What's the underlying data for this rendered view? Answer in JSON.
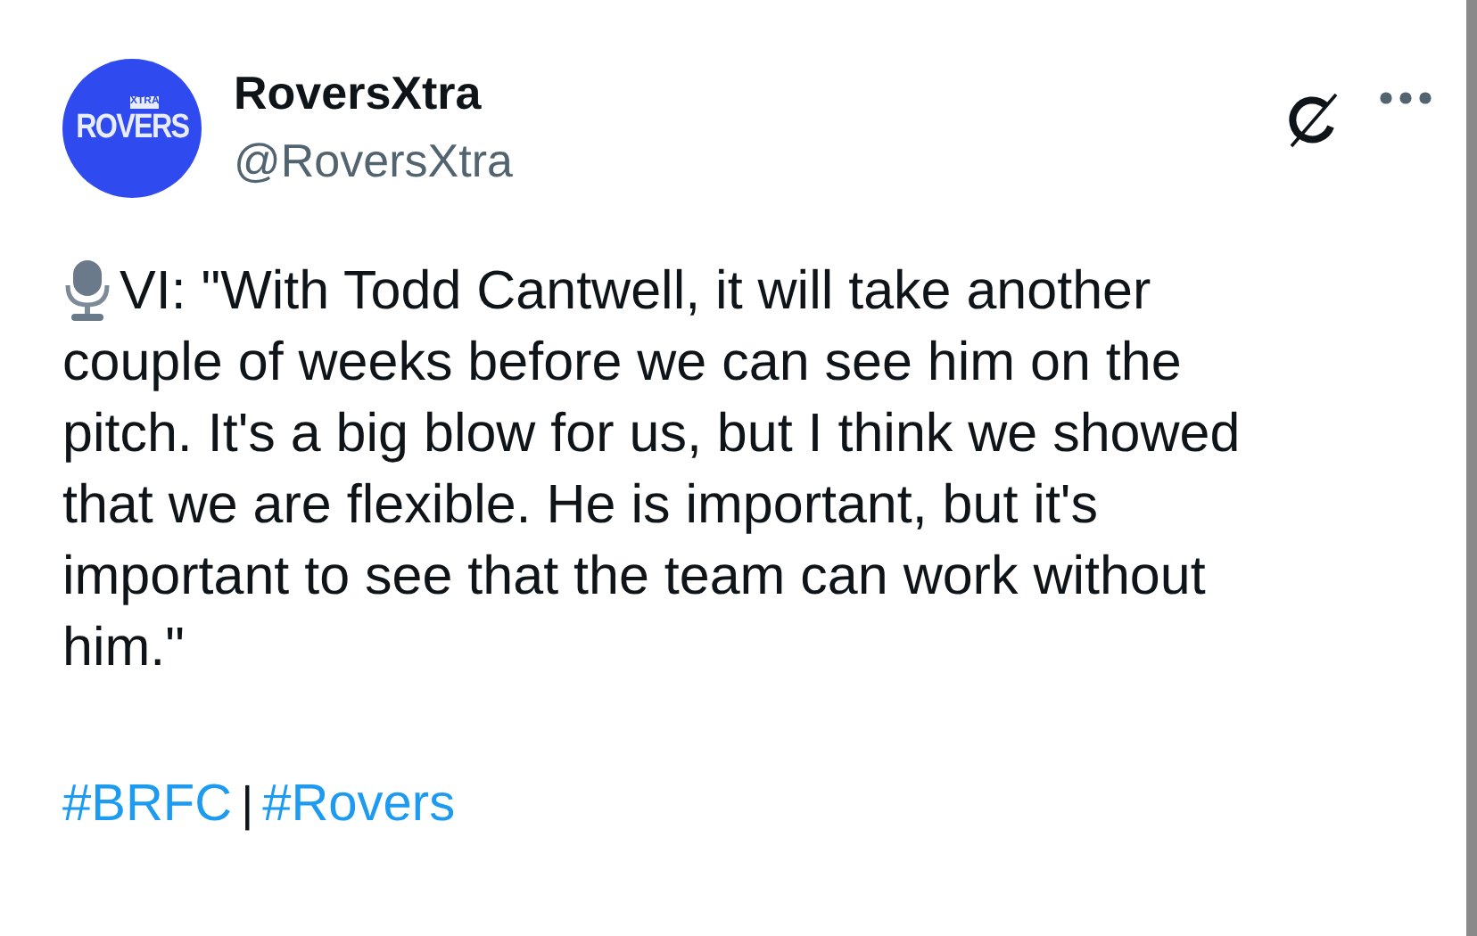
{
  "author": {
    "name": "RoversXtra",
    "handle": "@RoversXtra",
    "logo": {
      "sub": "XTRA",
      "text": "ROVERS"
    }
  },
  "body": [
    "VI: \"With Todd Cantwell, it will take another",
    "couple of weeks before we can see him on the pitch. It's a big blow for us, but I think we showed that we are flexible. He is important, but it's important to see that the team can work without him.\""
  ],
  "hashtags": [
    "#BRFC",
    "#Rovers"
  ],
  "separator": "|"
}
